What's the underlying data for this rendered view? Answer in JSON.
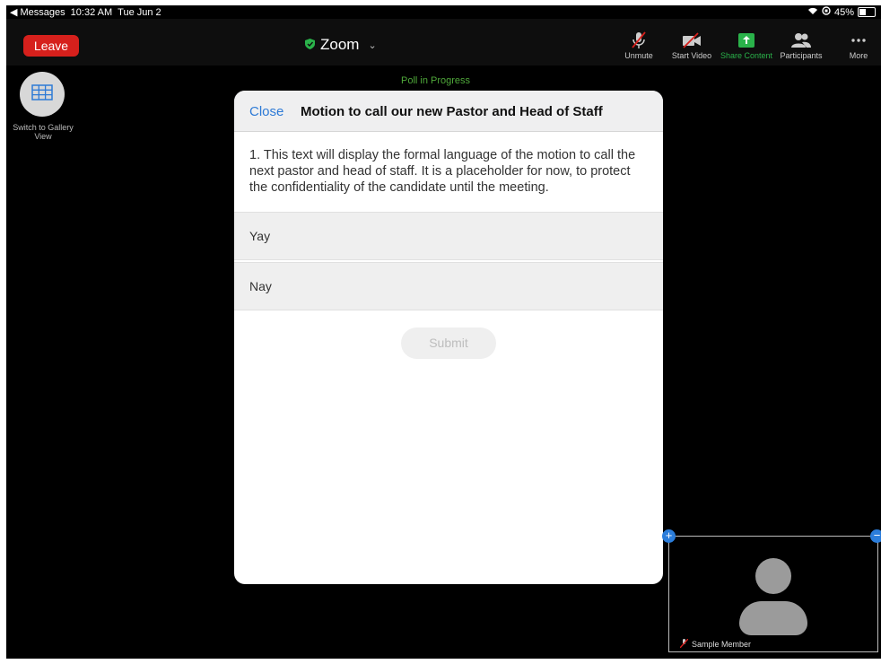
{
  "status_bar": {
    "back_app": "◀ Messages",
    "time": "10:32 AM",
    "date": "Tue Jun 2",
    "battery": "45%"
  },
  "toolbar": {
    "leave_label": "Leave",
    "title": "Zoom",
    "unmute_label": "Unmute",
    "start_video_label": "Start Video",
    "share_label": "Share Content",
    "participants_label": "Participants",
    "more_label": "More"
  },
  "gallery": {
    "label": "Switch to Gallery View"
  },
  "poll_status": "Poll in Progress",
  "poll": {
    "close_label": "Close",
    "title": "Motion to call our new Pastor and Head of Staff",
    "question": "1. This text will display the formal language of the motion to call the next pastor and head of staff.  It is a placeholder for now, to protect the confidentiality of the candidate until the meeting.",
    "options": [
      "Yay",
      "Nay"
    ],
    "submit_label": "Submit"
  },
  "self_view": {
    "name": "Sample Member"
  },
  "colors": {
    "leave": "#d6201c",
    "accent_blue": "#2d7ad6",
    "share_green": "#2ab24a"
  }
}
